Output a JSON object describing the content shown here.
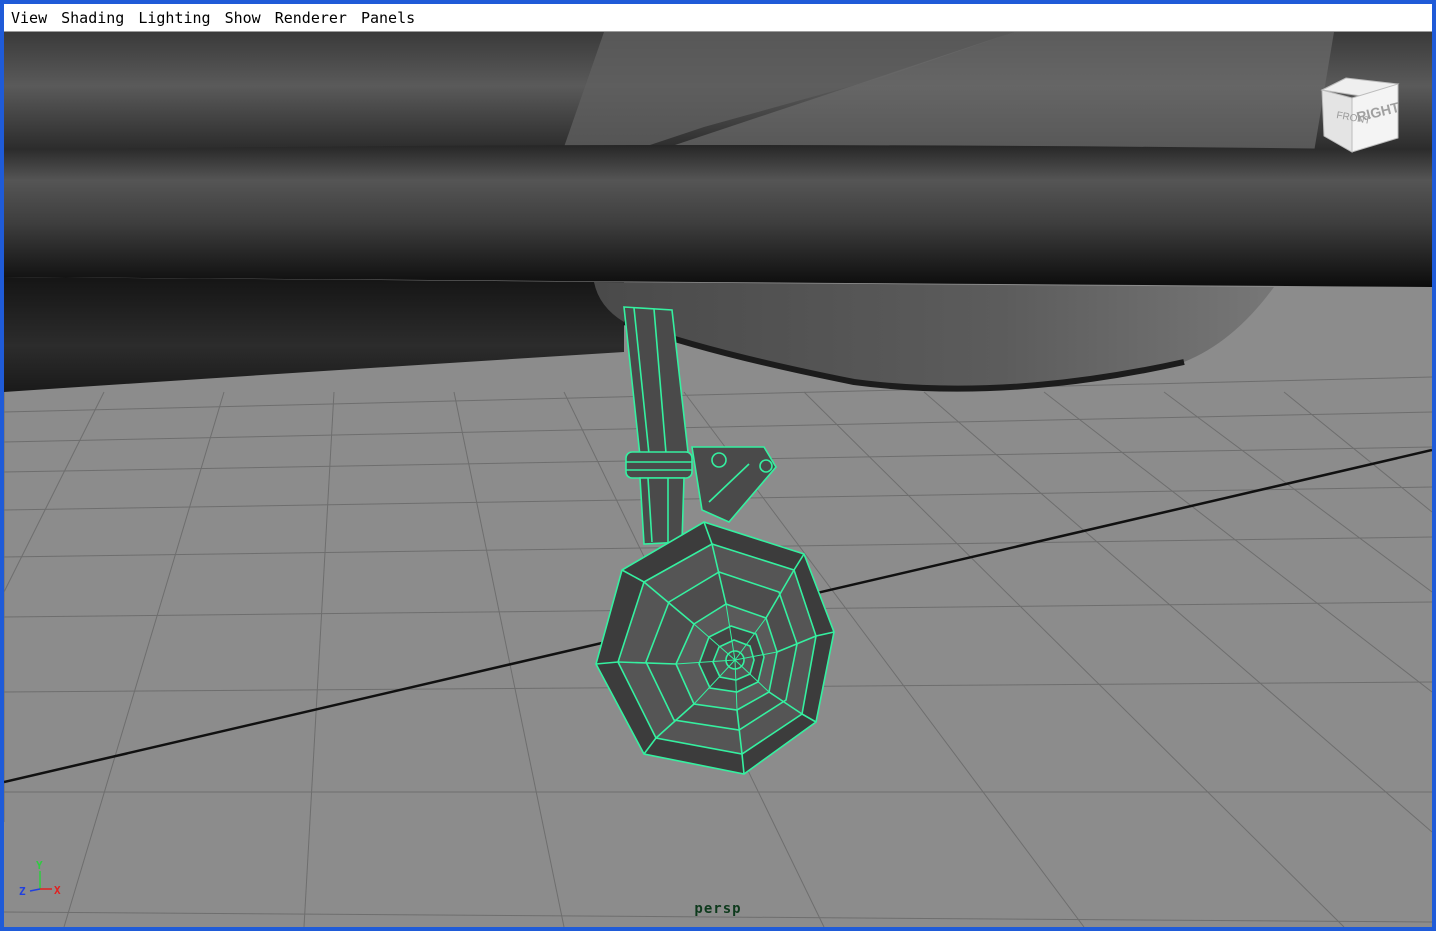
{
  "menubar": {
    "items": [
      {
        "label": "View"
      },
      {
        "label": "Shading"
      },
      {
        "label": "Lighting"
      },
      {
        "label": "Show"
      },
      {
        "label": "Renderer"
      },
      {
        "label": "Panels"
      }
    ]
  },
  "viewcube": {
    "front_label": "FRONT",
    "right_label": "RIGHT"
  },
  "axis_gizmo": {
    "y_label": "Y",
    "z_label": "Z",
    "x_label": "X"
  },
  "camera": {
    "label": "persp"
  },
  "colors": {
    "selection_wireframe": "#35f0a0",
    "grid_background": "#8a8a8a",
    "window_border": "#1f5bd8"
  }
}
